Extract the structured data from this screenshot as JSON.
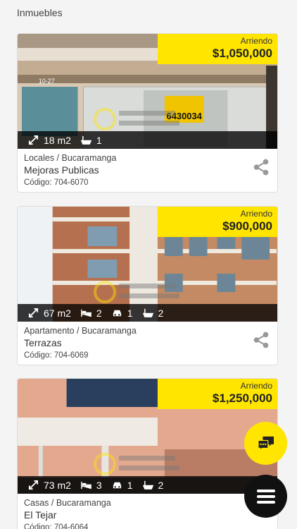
{
  "page": {
    "section_title": "Inmuebles"
  },
  "listings": [
    {
      "price_type": "Arriendo",
      "price": "$1,050,000",
      "area": "18 m2",
      "baths": "1",
      "category": "Locales / Bucaramanga",
      "name": "Mejoras Publicas",
      "code": "Código: 704-6070"
    },
    {
      "price_type": "Arriendo",
      "price": "$900,000",
      "area": "67 m2",
      "beds": "2",
      "parking": "1",
      "baths": "2",
      "category": "Apartamento / Bucaramanga",
      "name": "Terrazas",
      "code": "Código: 704-6069"
    },
    {
      "price_type": "Arriendo",
      "price": "$1,250,000",
      "area": "73 m2",
      "beds": "3",
      "parking": "1",
      "baths": "2",
      "category": "Casas / Bucaramanga",
      "name": "El Tejar",
      "code": "Código: 704-6064"
    }
  ],
  "photo_signs": {
    "sign_number": "6430034",
    "street_number": "10-27"
  },
  "colors": {
    "accent": "#ffe500",
    "overlay": "#000000"
  },
  "icons": [
    "area-icon",
    "bed-icon",
    "car-icon",
    "bath-icon",
    "share-icon",
    "chat-icon",
    "menu-icon"
  ]
}
